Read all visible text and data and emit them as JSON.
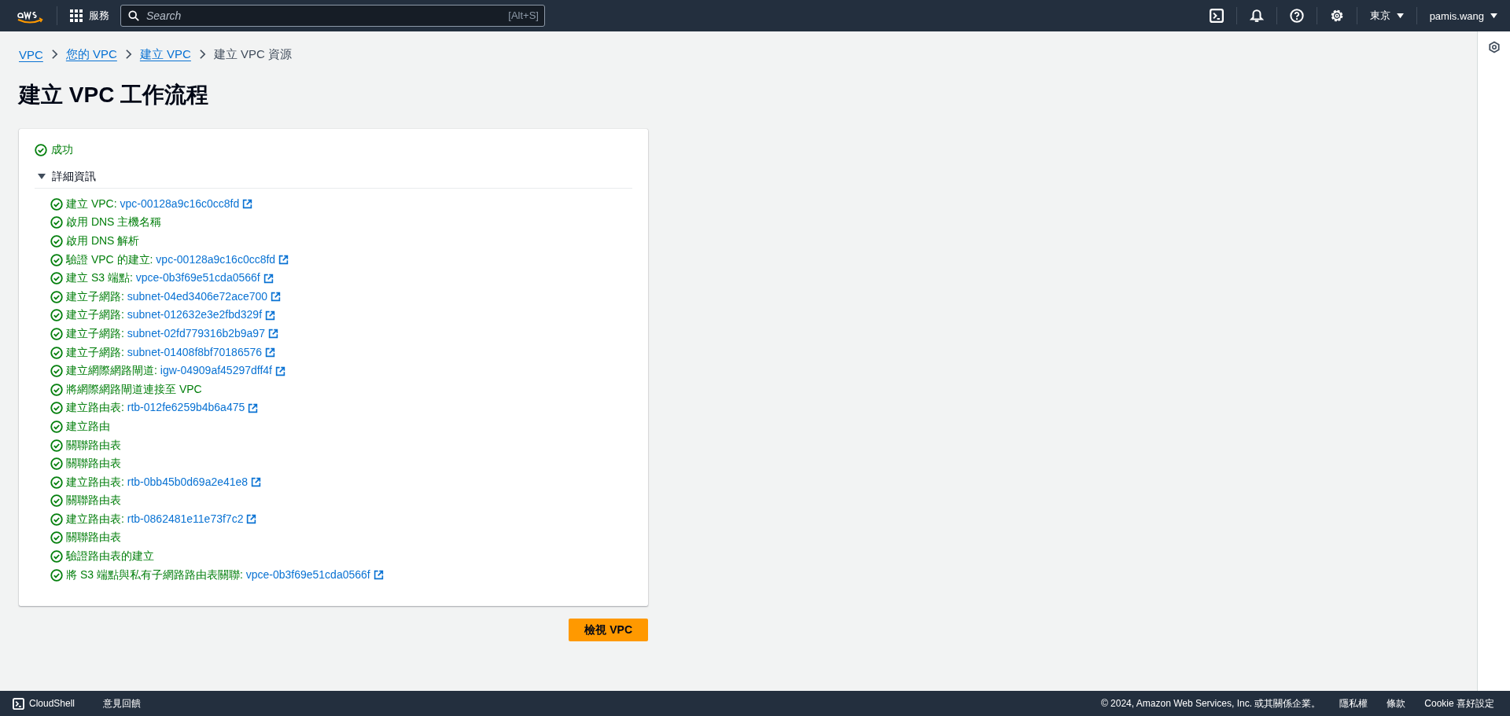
{
  "top_bar": {
    "services_label": "服務",
    "search": {
      "placeholder": "Search",
      "shortcut": "[Alt+S]"
    },
    "region": "東京",
    "user": "pamis.wang"
  },
  "breadcrumbs": [
    {
      "label": "VPC",
      "link": true
    },
    {
      "label": "您的 VPC",
      "link": true
    },
    {
      "label": "建立 VPC",
      "link": true
    },
    {
      "label": "建立 VPC 資源",
      "link": false
    }
  ],
  "title": "建立 VPC 工作流程",
  "result": {
    "status": "成功",
    "details": {
      "label": "詳細資訊",
      "expanded": true,
      "steps": [
        {
          "label": "建立 VPC: ",
          "resource": "vpc-00128a9c16c0cc8fd"
        },
        {
          "label": "啟用 DNS 主機名稱"
        },
        {
          "label": "啟用 DNS 解析"
        },
        {
          "label": "驗證 VPC 的建立: ",
          "resource": "vpc-00128a9c16c0cc8fd"
        },
        {
          "label": "建立 S3 端點: ",
          "resource": "vpce-0b3f69e51cda0566f"
        },
        {
          "label": "建立子網路: ",
          "resource": "subnet-04ed3406e72ace700"
        },
        {
          "label": "建立子網路: ",
          "resource": "subnet-012632e3e2fbd329f"
        },
        {
          "label": "建立子網路: ",
          "resource": "subnet-02fd779316b2b9a97"
        },
        {
          "label": "建立子網路: ",
          "resource": "subnet-01408f8bf70186576"
        },
        {
          "label": "建立網際網路閘道: ",
          "resource": "igw-04909af45297dff4f"
        },
        {
          "label": "將網際網路閘道連接至 VPC"
        },
        {
          "label": "建立路由表: ",
          "resource": "rtb-012fe6259b4b6a475"
        },
        {
          "label": "建立路由"
        },
        {
          "label": "關聯路由表"
        },
        {
          "label": "關聯路由表"
        },
        {
          "label": "建立路由表: ",
          "resource": "rtb-0bb45b0d69a2e41e8"
        },
        {
          "label": "關聯路由表"
        },
        {
          "label": "建立路由表: ",
          "resource": "rtb-0862481e11e73f7c2"
        },
        {
          "label": "關聯路由表"
        },
        {
          "label": "驗證路由表的建立"
        },
        {
          "label": "將 S3 端點與私有子網路路由表關聯: ",
          "resource": "vpce-0b3f69e51cda0566f"
        }
      ]
    }
  },
  "primary_button": "檢視 VPC",
  "footer": {
    "cloudshell": "CloudShell",
    "feedback": "意見回饋",
    "copyright": "© 2024, Amazon Web Services, Inc. 或其關係企業。",
    "links": [
      "隱私權",
      "條款",
      "Cookie 喜好設定"
    ]
  }
}
